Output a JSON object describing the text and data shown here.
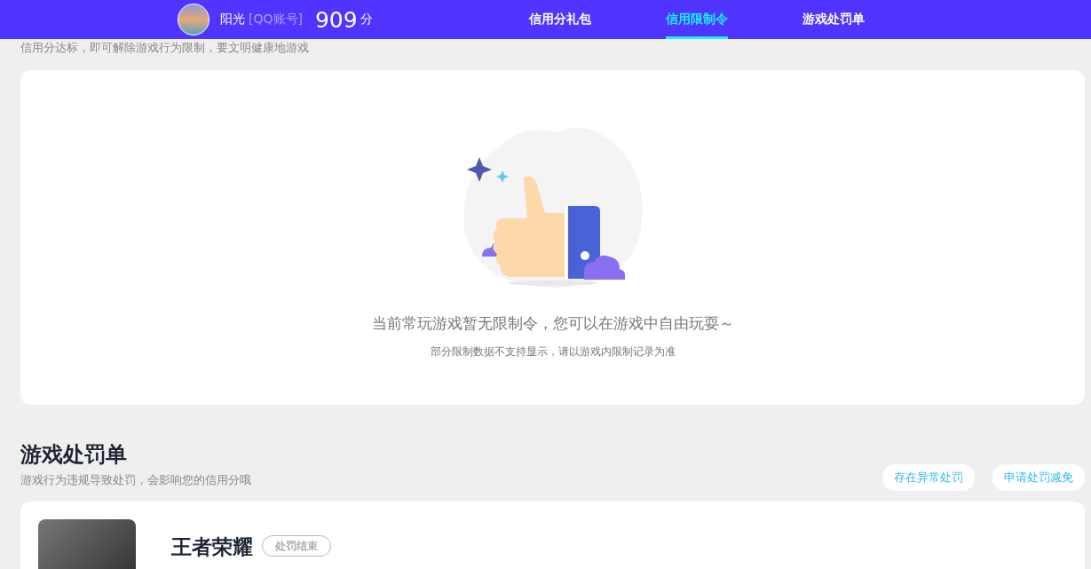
{
  "header": {
    "user_name": "阳光",
    "account_type": "[QQ账号]",
    "score": "909",
    "score_unit": "分"
  },
  "tabs": [
    {
      "label": "信用分礼包",
      "selected": false
    },
    {
      "label": "信用限制令",
      "selected": true
    },
    {
      "label": "游戏处罚单",
      "selected": false
    }
  ],
  "restriction_section": {
    "subtitle": "信用分达标，即可解除游戏行为限制，要文明健康地游戏",
    "empty_message": "当前常玩游戏暂无限制令，您可以在游戏中自由玩耍～",
    "empty_note": "部分限制数据不支持显示，请以游戏内限制记录为准"
  },
  "penalty_section": {
    "title": "游戏处罚单",
    "subtitle": "游戏行为违规导致处罚，会影响您的信用分哦",
    "buttons": [
      "存在异常处罚",
      "申请处罚减免"
    ],
    "items": [
      {
        "game": "王者荣耀",
        "status": "处罚结束"
      }
    ]
  }
}
